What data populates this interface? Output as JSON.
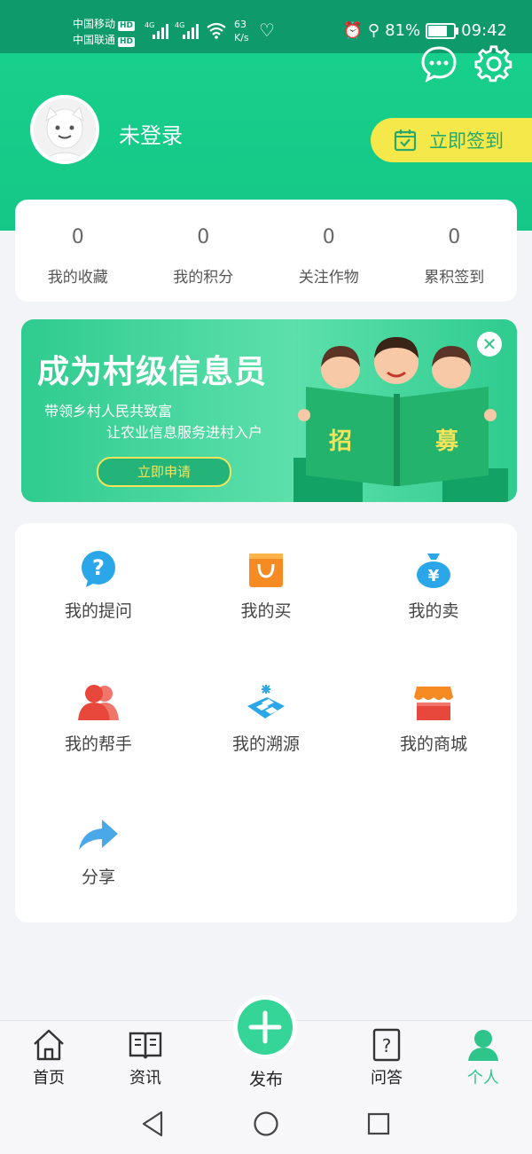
{
  "status_bar": {
    "carrier1": "中国移动",
    "carrier2": "中国联通",
    "hd": "HD",
    "net1": "4G",
    "net2": "4G",
    "speed_value": "63",
    "speed_unit": "K/s",
    "battery": "81%",
    "battery_level": 0.81,
    "time": "09:42"
  },
  "profile": {
    "username": "未登录",
    "signin_label": "立即签到"
  },
  "stats": [
    {
      "value": "0",
      "label": "我的收藏"
    },
    {
      "value": "0",
      "label": "我的积分"
    },
    {
      "value": "0",
      "label": "关注作物"
    },
    {
      "value": "0",
      "label": "累积签到"
    }
  ],
  "banner": {
    "title": "成为村级信息员",
    "subtitle1": "带领乡村人民共致富",
    "subtitle2": "让农业信息服务进村入户",
    "button": "立即申请",
    "book_left": "招",
    "book_right": "募"
  },
  "menu": [
    {
      "label": "我的提问",
      "icon": "question-icon"
    },
    {
      "label": "我的买",
      "icon": "shopping-bag-icon"
    },
    {
      "label": "我的卖",
      "icon": "money-bag-icon"
    },
    {
      "label": "我的帮手",
      "icon": "helpers-icon"
    },
    {
      "label": "我的溯源",
      "icon": "traceability-icon"
    },
    {
      "label": "我的商城",
      "icon": "store-icon"
    },
    {
      "label": "分享",
      "icon": "share-icon"
    }
  ],
  "tabs": {
    "home": "首页",
    "news": "资讯",
    "publish": "发布",
    "qa": "问答",
    "me": "个人"
  },
  "colors": {
    "primary": "#15c787",
    "active_tab": "#2fc58a",
    "signin_bg": "#f5e84a"
  }
}
